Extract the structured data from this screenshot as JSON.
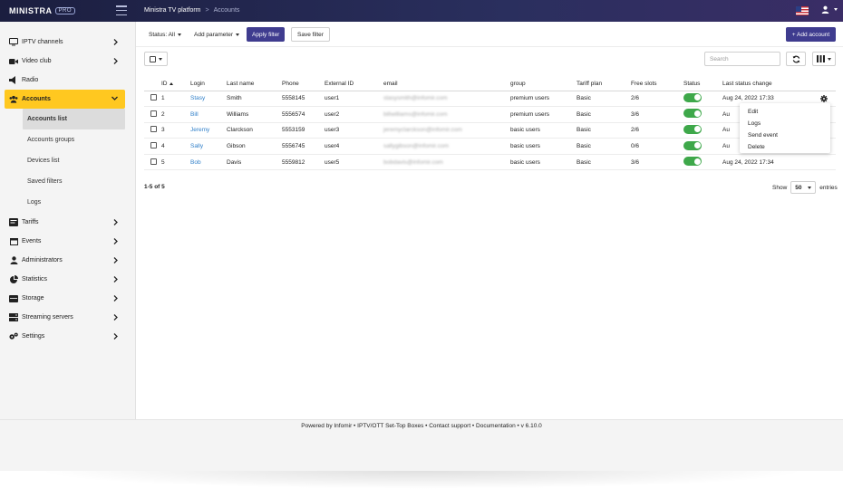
{
  "app": {
    "logo": "MINISTRA",
    "logo_badge": "PRO"
  },
  "breadcrumb": {
    "root": "Ministra TV platform",
    "separator": ">",
    "current": "Accounts"
  },
  "sidebar": {
    "items": [
      {
        "label": "IPTV channels",
        "icon": "monitor-icon"
      },
      {
        "label": "Video club",
        "icon": "video-icon"
      },
      {
        "label": "Radio",
        "icon": "radio-icon"
      },
      {
        "label": "Accounts",
        "icon": "users-icon"
      },
      {
        "label": "Tariffs",
        "icon": "tariffs-icon"
      },
      {
        "label": "Events",
        "icon": "calendar-icon"
      },
      {
        "label": "Administrators",
        "icon": "admin-icon"
      },
      {
        "label": "Statistics",
        "icon": "pie-chart-icon"
      },
      {
        "label": "Storage",
        "icon": "storage-icon"
      },
      {
        "label": "Streaming servers",
        "icon": "server-icon"
      },
      {
        "label": "Settings",
        "icon": "gears-icon"
      }
    ],
    "sub_items": [
      "Accounts list",
      "Accounts groups",
      "Devices list",
      "Saved filters",
      "Logs"
    ]
  },
  "filters": {
    "status": "Status: All",
    "add_parameter": "Add parameter",
    "apply": "Apply filter",
    "save": "Save filter",
    "add_account": "+ Add account"
  },
  "search": {
    "placeholder": "Search"
  },
  "table": {
    "headers": [
      "ID",
      "Login",
      "Last name",
      "Phone",
      "External ID",
      "email",
      "group",
      "Tariff plan",
      "Free slots",
      "Status",
      "Last status change"
    ],
    "rows": [
      {
        "id": "1",
        "login": "Stasy",
        "last_name": "Smith",
        "phone": "5558145",
        "external_id": "user1",
        "email": "stasysmith@infomir.com",
        "group": "premium users",
        "tariff": "Basic",
        "slots": "2/6",
        "status": "on",
        "changed": "Aug 24, 2022 17:33"
      },
      {
        "id": "2",
        "login": "Bill",
        "last_name": "Williams",
        "phone": "5556574",
        "external_id": "user2",
        "email": "billwilliams@infomir.com",
        "group": "premium users",
        "tariff": "Basic",
        "slots": "3/6",
        "status": "on",
        "changed": "Au"
      },
      {
        "id": "3",
        "login": "Jeremy",
        "last_name": "Clarckson",
        "phone": "5553159",
        "external_id": "user3",
        "email": "jeremyclarckson@infomir.com",
        "group": "basic users",
        "tariff": "Basic",
        "slots": "2/6",
        "status": "on",
        "changed": "Au"
      },
      {
        "id": "4",
        "login": "Sally",
        "last_name": "Gibson",
        "phone": "5556745",
        "external_id": "user4",
        "email": "sallygibson@infomir.com",
        "group": "basic users",
        "tariff": "Basic",
        "slots": "0/6",
        "status": "on",
        "changed": "Au"
      },
      {
        "id": "5",
        "login": "Bob",
        "last_name": "Davis",
        "phone": "5559812",
        "external_id": "user5",
        "email": "bobdavis@infomir.com",
        "group": "basic users",
        "tariff": "Basic",
        "slots": "3/6",
        "status": "on",
        "changed": "Aug 24, 2022 17:34"
      }
    ]
  },
  "context_menu": [
    "Edit",
    "Logs",
    "Send event",
    "Delete"
  ],
  "pagination": {
    "info": "1-5 of 5",
    "show_label": "Show",
    "page_size": "50",
    "entries_label": "entries"
  },
  "footer": {
    "text": "Powered by Infomir • IPTV/OTT Set-Top Boxes • Contact support • Documentation • v 6.10.0"
  },
  "colors": {
    "accent": "#3f3c8f",
    "active_nav": "#ffc820",
    "toggle_on": "#3ea84a",
    "link": "#2f7fc9",
    "topbar": "#1b1e3f"
  }
}
